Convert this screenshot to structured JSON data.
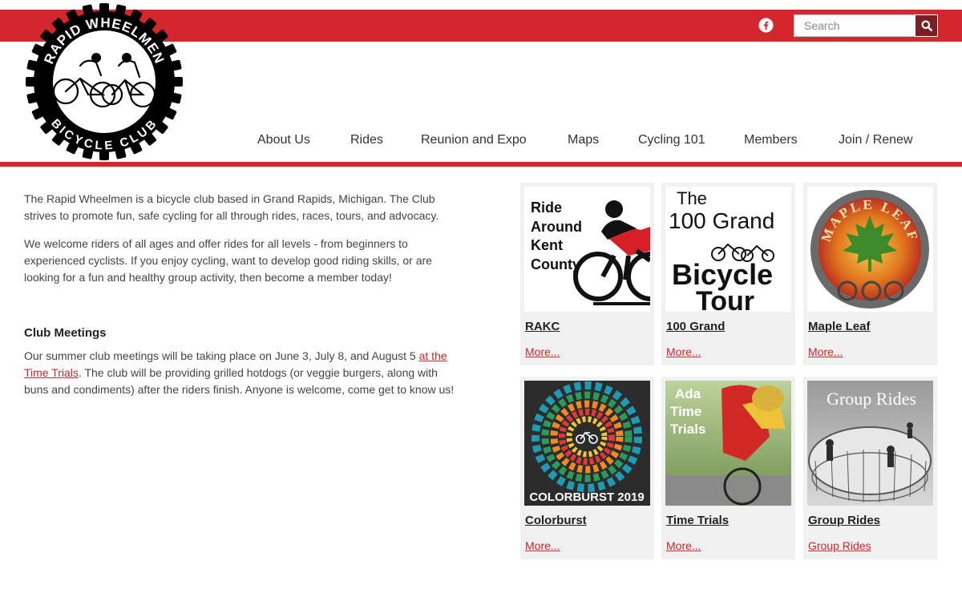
{
  "header": {
    "social_icon": "facebook-icon",
    "search": {
      "placeholder": "Search",
      "value": "",
      "button_icon": "search-icon"
    },
    "logo": {
      "top_text": "RAPID WHEELMEN",
      "bottom_text": "BICYCLE CLUB"
    }
  },
  "nav": {
    "items": [
      {
        "label": "About Us"
      },
      {
        "label": "Rides"
      },
      {
        "label": "Reunion and Expo"
      },
      {
        "label": "Maps"
      },
      {
        "label": "Cycling 101"
      },
      {
        "label": "Members"
      },
      {
        "label": "Join / Renew"
      }
    ]
  },
  "intro": {
    "p1": "The Rapid Wheelmen is a bicycle club based in Grand Rapids, Michigan. The Club strives to promote fun, safe cycling for all through rides, races, tours, and advocacy.",
    "p2": "We welcome riders of all ages and offer rides for all levels - from beginners to experienced cyclists. If you enjoy cycling, want to develop good riding skills, or are looking for a fun and healthy group activity, then become a member today!"
  },
  "meetings": {
    "heading": "Club Meetings",
    "text_before": "Our summer club meetings will be taking place on June 3, July 8, and August 5 ",
    "link": "at the Time Trials",
    "text_after": ". The club will be providing grilled hotdogs (or veggie burgers, along with buns and condiments) after the riders finish.  Anyone is welcome, come get to know us!"
  },
  "cards": [
    {
      "title": "RAKC",
      "link": "More...",
      "image": {
        "lines": [
          "Ride",
          "Around",
          "Kent",
          "County"
        ]
      }
    },
    {
      "title": "100 Grand",
      "link": "More...",
      "image": {
        "line1": "The",
        "line2": "100 Grand",
        "line3": "Bicycle",
        "line4": "Tour"
      }
    },
    {
      "title": "Maple Leaf",
      "link": "More...",
      "image": {
        "arc_text": "MAPLE LEAF"
      }
    },
    {
      "title": "Colorburst",
      "link": "More...",
      "image": {
        "caption": "COLORBURST 2019"
      }
    },
    {
      "title": "Time Trials",
      "link": "More...",
      "image": {
        "lines": [
          "Ada",
          "Time",
          "Trials"
        ]
      }
    },
    {
      "title": "Group Rides",
      "link": "Group Rides",
      "image": {
        "caption": "Group Rides"
      }
    }
  ],
  "colors": {
    "brand_red": "#d3262d",
    "link_red": "#c9252c",
    "search_button": "#7a1f23"
  }
}
